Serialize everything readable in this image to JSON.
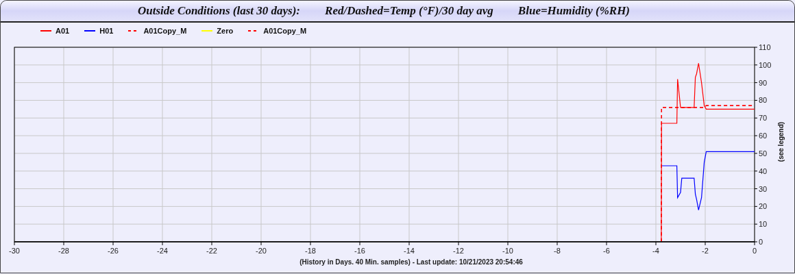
{
  "title": [
    "Outside Conditions (last 30 days):",
    "Red/Dashed=Temp (°F)/30 day avg",
    "Blue=Humidity (%RH)"
  ],
  "chart_data": {
    "type": "line",
    "grid": true,
    "ylabel": "(see legend)",
    "xlim": [
      -30,
      0
    ],
    "ylim": [
      0,
      110
    ],
    "xticks": [
      -30,
      -28,
      -26,
      -24,
      -22,
      -20,
      -18,
      -16,
      -14,
      -12,
      -10,
      -8,
      -6,
      -4,
      -2,
      0
    ],
    "yticks": [
      0,
      10,
      20,
      30,
      40,
      50,
      60,
      70,
      80,
      90,
      100,
      110
    ],
    "x": [
      -3.78,
      -3.77,
      -3.15,
      -3.12,
      -3.0,
      -2.95,
      -2.45,
      -2.4,
      -2.35,
      -2.27,
      -2.15,
      -2.04,
      -1.96,
      0
    ],
    "series": [
      {
        "name": "A01",
        "color": "#ff0000",
        "line_style": "solid",
        "values": [
          0,
          67,
          67,
          92,
          76,
          76,
          76,
          93,
          95,
          101,
          90,
          77,
          75,
          75
        ]
      },
      {
        "name": "H01",
        "color": "#0000ff",
        "line_style": "solid",
        "values": [
          null,
          43,
          43,
          25,
          28,
          36,
          36,
          27,
          24,
          18,
          25,
          45,
          51,
          51
        ]
      },
      {
        "name": "A01Copy_M",
        "color": "#ff0000",
        "line_style": "dashed",
        "values": [
          0,
          76,
          76,
          76,
          76,
          76,
          76,
          76,
          76,
          76,
          76,
          76,
          77,
          77
        ]
      },
      {
        "name": "Zero",
        "color": "#ffff00",
        "line_style": "solid",
        "values": [
          null,
          null,
          null,
          null,
          null,
          null,
          null,
          null,
          null,
          null,
          null,
          null,
          null,
          null
        ]
      },
      {
        "name": "A01Copy_M",
        "color": "#ff0000",
        "line_style": "dashed",
        "values": [
          0,
          76,
          76,
          76,
          76,
          76,
          76,
          76,
          76,
          76,
          76,
          76,
          77,
          77
        ]
      }
    ]
  },
  "footer": "(History in Days. 40 Min. samples) - Last update: 10/21/2023 20:54:46"
}
